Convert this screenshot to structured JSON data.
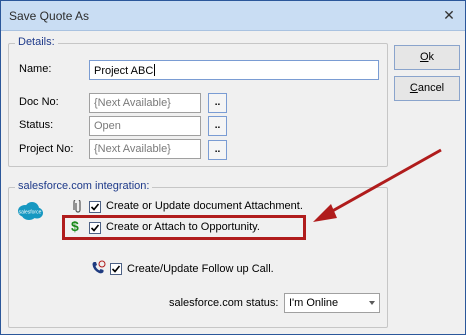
{
  "window": {
    "title": "Save Quote As",
    "close_glyph": "✕"
  },
  "details": {
    "legend": "Details:",
    "name_label": "Name:",
    "name_value": "Project ABC",
    "docno_label": "Doc No:",
    "docno_value": "{Next Available}",
    "status_label": "Status:",
    "status_value": "Open",
    "projectno_label": "Project No:",
    "projectno_value": "{Next Available}",
    "ellipsis_label": ".."
  },
  "buttons": {
    "ok_accel": "O",
    "ok_rest": "k",
    "cancel_accel": "C",
    "cancel_rest": "ancel"
  },
  "integration": {
    "legend": "salesforce.com integration:",
    "logo_text": "salesforce",
    "attach_option": "Create or Update document Attachment.",
    "opportunity_option": "Create or Attach to Opportunity.",
    "dollar_glyph": "$",
    "followup_option": "Create/Update Follow up Call.",
    "status_label": "salesforce.com status:",
    "status_value": "I'm Online"
  },
  "colors": {
    "highlight": "#b01c1c",
    "arrow": "#b01c1c",
    "legend": "#1e3a8a"
  }
}
